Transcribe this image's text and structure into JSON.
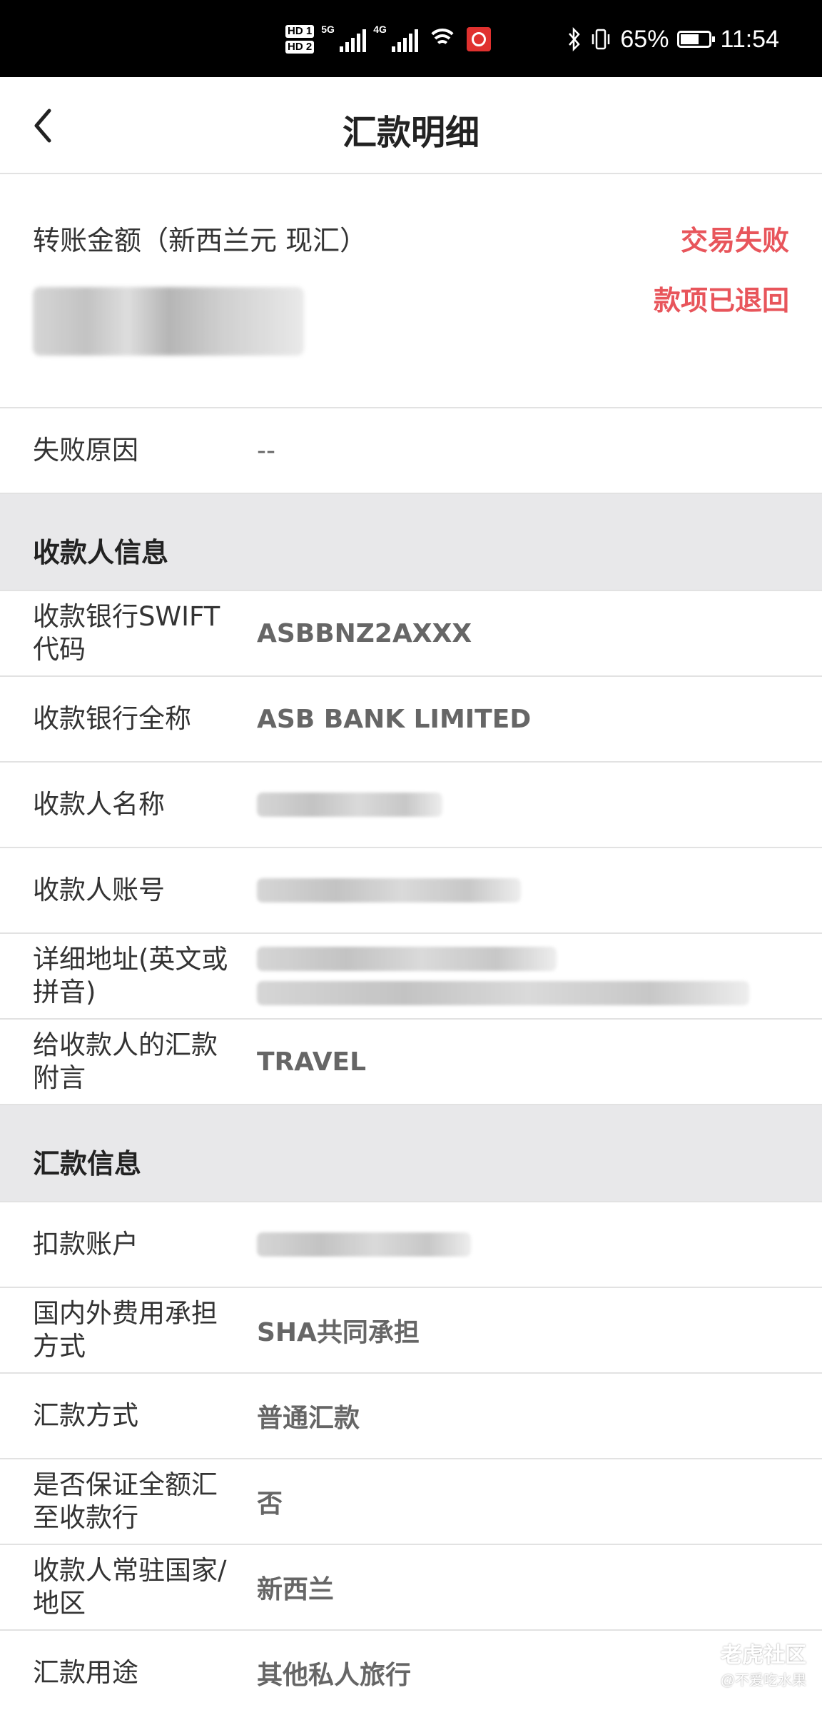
{
  "status_bar": {
    "hd1": "HD 1",
    "hd2": "HD 2",
    "sim1_network": "5G",
    "sim2_network": "4G",
    "bluetooth_icon": "bluetooth-icon",
    "vibrate_icon": "vibrate-icon",
    "battery_percent": "65%",
    "battery_level": 0.65,
    "time": "11:54"
  },
  "header": {
    "title": "汇款明细",
    "back_icon": "chevron-left-icon"
  },
  "amount_block": {
    "label": "转账金额（新西兰元 现汇）",
    "status_line1": "交易失败",
    "status_line2": "款项已退回",
    "status_color": "#e8555b"
  },
  "failure_row": {
    "label": "失败原因",
    "value": "--"
  },
  "payee_section": {
    "title": "收款人信息",
    "rows": [
      {
        "label": "收款银行SWIFT代码",
        "value": "ASBBNZ2AXXX"
      },
      {
        "label": "收款银行全称",
        "value": "ASB BANK LIMITED"
      },
      {
        "label": "收款人名称",
        "value": ""
      },
      {
        "label": "收款人账号",
        "value": ""
      },
      {
        "label": "详细地址(英文或拼音)",
        "value": ""
      },
      {
        "label": "给收款人的汇款附言",
        "value": "TRAVEL"
      }
    ]
  },
  "remit_section": {
    "title": "汇款信息",
    "rows": [
      {
        "label": "扣款账户",
        "value": ""
      },
      {
        "label": "国内外费用承担方式",
        "value": "SHA共同承担"
      },
      {
        "label": "汇款方式",
        "value": "普通汇款"
      },
      {
        "label": "是否保证全额汇至收款行",
        "value": "否"
      },
      {
        "label": "收款人常驻国家/地区",
        "value": "新西兰"
      },
      {
        "label": "汇款用途",
        "value": "其他私人旅行"
      }
    ]
  },
  "watermark": {
    "line1": "老虎社区",
    "line2": "@不爱吃水果"
  }
}
